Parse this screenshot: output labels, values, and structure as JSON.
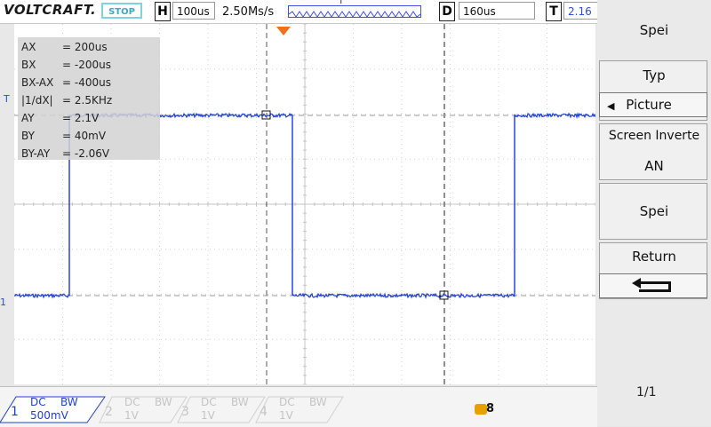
{
  "topbar": {
    "brand": "VOLTCRAFT.",
    "status": "STOP",
    "h_letter": "H",
    "timebase": "100us",
    "sample_rate": "2.50Ms/s",
    "trig_marker": "T",
    "d_letter": "D",
    "delay": "160us",
    "t_letter": "T",
    "trig_level": "2.16"
  },
  "cursor_readout": [
    {
      "label": "AX",
      "value": "= 200us"
    },
    {
      "label": "BX",
      "value": "= -200us"
    },
    {
      "label": "BX-AX",
      "value": "= -400us"
    },
    {
      "label": "|1/dX|",
      "value": "= 2.5KHz"
    },
    {
      "label": "AY",
      "value": "= 2.1V"
    },
    {
      "label": "BY",
      "value": "= 40mV"
    },
    {
      "label": "BY-AY",
      "value": "= -2.06V"
    }
  ],
  "markers": {
    "trigger_level": "T",
    "ground": "1"
  },
  "panel": {
    "title": "Spei",
    "typ_label": "Typ",
    "typ_value": "Picture",
    "screen_inverted_label": "Screen Inverte",
    "screen_inverted_value": "AN",
    "save_label": "Spei",
    "return_label": "Return",
    "page": "1/1"
  },
  "channels": [
    {
      "num": "1",
      "coupling": "DC",
      "bw": "BW",
      "scale": "500mV",
      "active": true
    },
    {
      "num": "2",
      "coupling": "DC",
      "bw": "BW",
      "scale": "1V",
      "active": false
    },
    {
      "num": "3",
      "coupling": "DC",
      "bw": "BW",
      "scale": "1V",
      "active": false
    },
    {
      "num": "4",
      "coupling": "DC",
      "bw": "BW",
      "scale": "1V",
      "active": false
    }
  ],
  "colors": {
    "trace": "#1f3fd6",
    "trigger": "#f07020",
    "accent": "#39a9c7"
  }
}
